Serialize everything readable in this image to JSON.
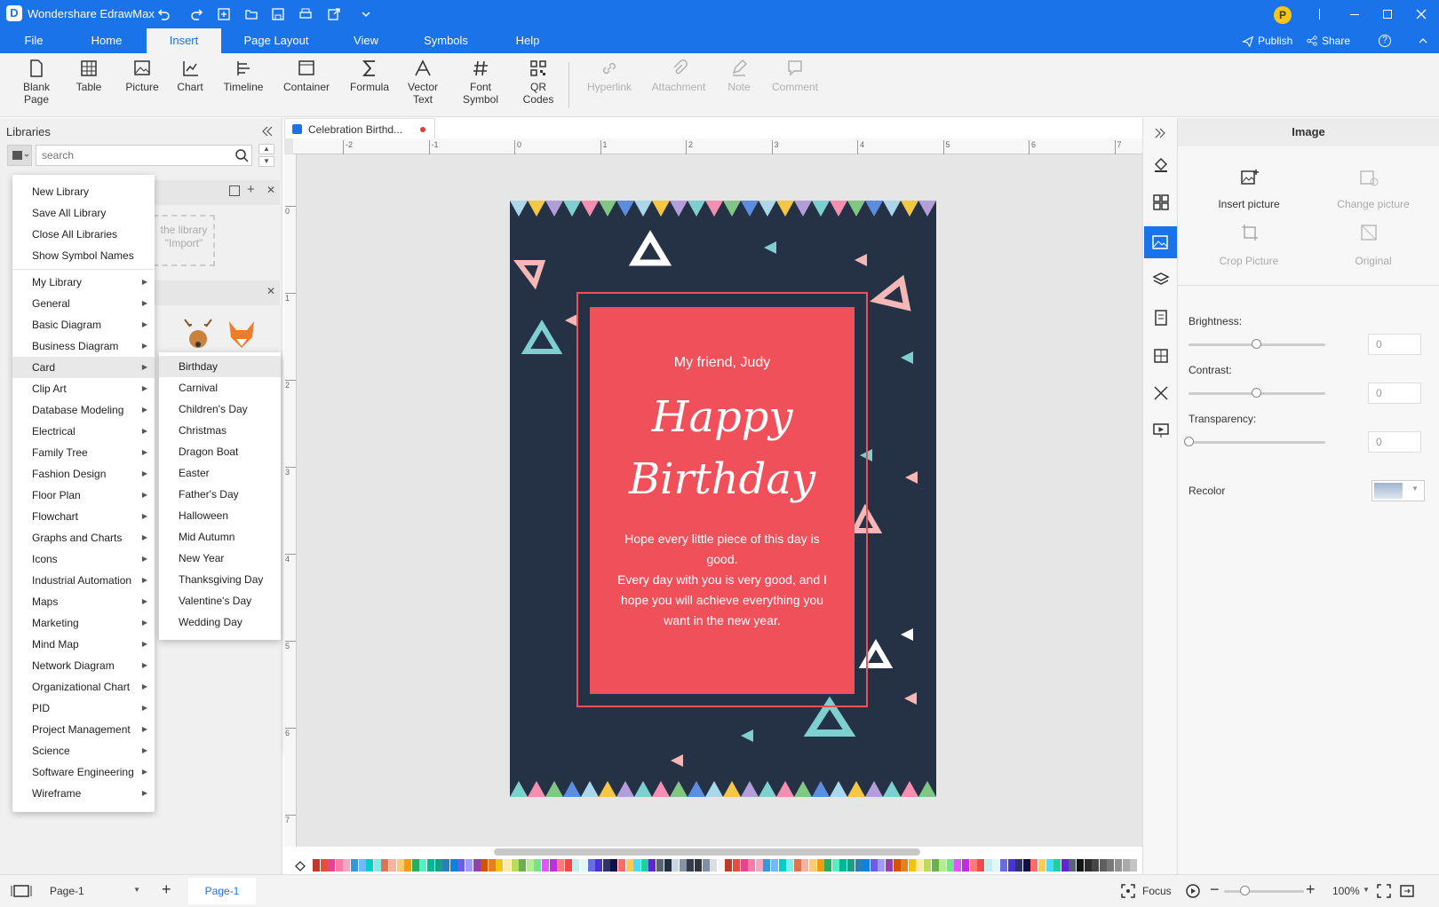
{
  "app": {
    "title": "Wondershare EdrawMax"
  },
  "header": {
    "publish": "Publish",
    "share": "Share",
    "avatar": "P"
  },
  "tabs": [
    {
      "label": "File"
    },
    {
      "label": "Home"
    },
    {
      "label": "Insert"
    },
    {
      "label": "Page Layout"
    },
    {
      "label": "View"
    },
    {
      "label": "Symbols"
    },
    {
      "label": "Help"
    }
  ],
  "toolbar": {
    "blank_page": "Blank\nPage",
    "table": "Table",
    "picture": "Picture",
    "chart": "Chart",
    "timeline": "Timeline",
    "container": "Container",
    "formula": "Formula",
    "vector_text": "Vector\nText",
    "font_symbol": "Font\nSymbol",
    "qr_codes": "QR\nCodes",
    "hyperlink": "Hyperlink",
    "attachment": "Attachment",
    "note": "Note",
    "comment": "Comment"
  },
  "libraries": {
    "title": "Libraries",
    "search_placeholder": "search",
    "hint_line1": "the library",
    "hint_line2": "\"Import\""
  },
  "menu": {
    "top": [
      "New Library",
      "Save All Library",
      "Close All Libraries",
      "Show Symbol Names"
    ],
    "items": [
      "My Library",
      "General",
      "Basic Diagram",
      "Business Diagram",
      "Card",
      "Clip Art",
      "Database Modeling",
      "Electrical",
      "Family Tree",
      "Fashion Design",
      "Floor Plan",
      "Flowchart",
      "Graphs and Charts",
      "Icons",
      "Industrial Automation",
      "Maps",
      "Marketing",
      "Mind Map",
      "Network Diagram",
      "Organizational Chart",
      "PID",
      "Project Management",
      "Science",
      "Software Engineering",
      "Wireframe"
    ]
  },
  "submenu": [
    "Birthday",
    "Carnival",
    "Children's Day",
    "Christmas",
    "Dragon Boat",
    "Easter",
    "Father's Day",
    "Halloween",
    "Mid Autumn",
    "New Year",
    "Thanksgiving Day",
    "Valentine's Day",
    "Wedding Day"
  ],
  "document": {
    "tab_title": "Celebration Birthd..."
  },
  "card": {
    "greeting": "My friend, Judy",
    "title1": "Happy",
    "title2": "Birthday",
    "body1": "Hope every little piece of this day is",
    "body2": "good.",
    "body3": "Every day with you is very good, and I",
    "body4": "hope you will achieve everything you",
    "body5": "want in the new year."
  },
  "rightpanel": {
    "title": "Image",
    "insert_picture": "Insert picture",
    "change_picture": "Change picture",
    "crop_picture": "Crop Picture",
    "original": "Original",
    "brightness": "Brightness:",
    "contrast": "Contrast:",
    "transparency": "Transparency:",
    "recolor": "Recolor",
    "brightness_value": "0",
    "contrast_value": "0",
    "transparency_value": "0"
  },
  "status": {
    "page_select": "Page-1",
    "page_tab": "Page-1",
    "focus": "Focus",
    "zoom": "100%"
  },
  "colors": {
    "accent": "#1a73e8",
    "card_bg": "#253246",
    "card_red": "#f0505a"
  },
  "ruler": {
    "h": [
      "-2",
      "-1",
      "0",
      "1",
      "2",
      "3",
      "4",
      "5",
      "6",
      "7"
    ],
    "v": [
      "0",
      "1",
      "2",
      "3",
      "4",
      "5",
      "6",
      "7"
    ]
  }
}
